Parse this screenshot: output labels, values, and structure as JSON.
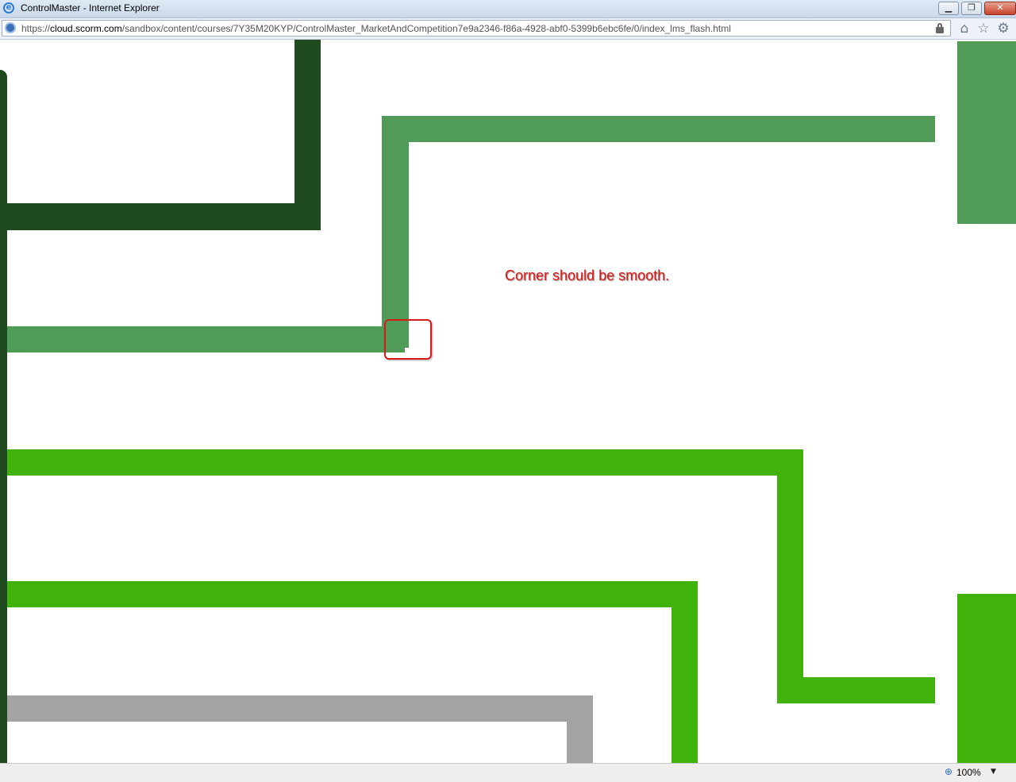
{
  "window": {
    "title": "ControlMaster - Internet Explorer",
    "minimize_glyph": "▁",
    "restore_glyph": "❐",
    "close_glyph": "✕"
  },
  "address": {
    "url_scheme": "https://",
    "url_host": "cloud.scorm.com",
    "url_path": "/sandbox/content/courses/7Y35M20KYP/ControlMaster_MarketAndCompetition7e9a2346-f86a-4928-abf0-5399b6ebc6fe/0/index_lms_flash.html"
  },
  "toolbar": {
    "home_icon": "⌂",
    "favorites_icon": "☆",
    "tools_icon": "⚙"
  },
  "annotation": {
    "text": "Corner should be smooth."
  },
  "status": {
    "zoom": "100%",
    "zoom_arrow": "▼"
  },
  "colors": {
    "dark_green": "#1f4a1d",
    "mid_green": "#4f9b57",
    "bright_green": "#41b209",
    "gray": "#a3a3a3",
    "annotation_red": "#e11414"
  }
}
